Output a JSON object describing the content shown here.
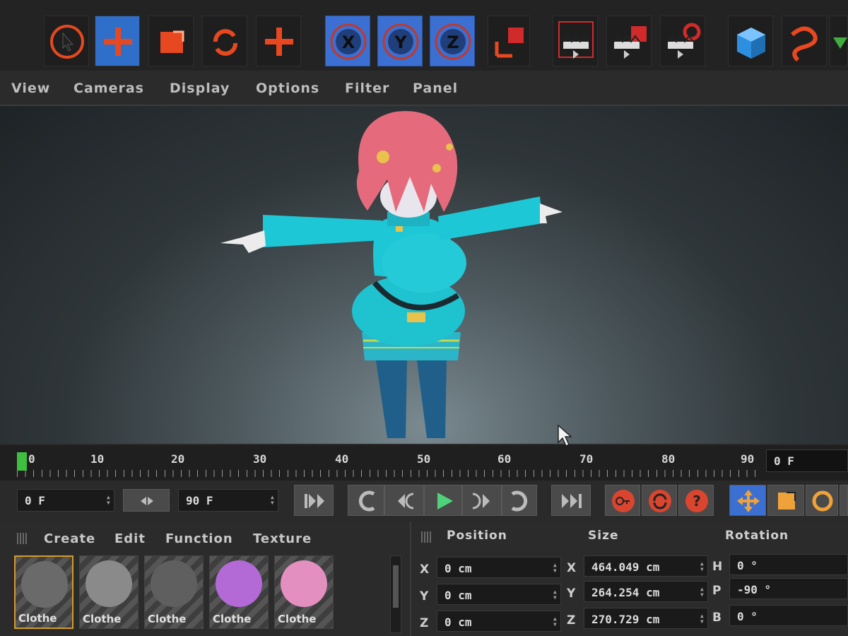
{
  "toolbar": {
    "tools": [
      {
        "name": "live-selection-icon"
      },
      {
        "name": "move-icon",
        "active": true
      },
      {
        "name": "scale-icon"
      },
      {
        "name": "rotate-icon"
      },
      {
        "name": "add-icon"
      }
    ],
    "axis_locks": [
      {
        "label": "X"
      },
      {
        "label": "Y"
      },
      {
        "label": "Z"
      }
    ],
    "right_tools": [
      {
        "name": "coordinate-system-icon"
      },
      {
        "name": "render-view-icon"
      },
      {
        "name": "render-to-picture-viewer-icon"
      },
      {
        "name": "render-settings-icon"
      },
      {
        "name": "cube-icon"
      },
      {
        "name": "spline-icon"
      }
    ],
    "accent_color": "#e8481f",
    "active_color": "#2f6fc9"
  },
  "viewport_menu": [
    "View",
    "Cameras",
    "Display",
    "Options",
    "Filter",
    "Panel"
  ],
  "timeline": {
    "ticks": [
      "0",
      "10",
      "20",
      "30",
      "40",
      "50",
      "60",
      "70",
      "80",
      "90"
    ],
    "current_frame_display": "0 F",
    "current_frame": 0,
    "max_frame": 90
  },
  "transport": {
    "start_field": "0 F",
    "end_field": "90 F",
    "buttons": [
      {
        "name": "go-to-start-icon"
      },
      {
        "name": "previous-key-icon"
      },
      {
        "name": "previous-frame-icon"
      },
      {
        "name": "play-icon"
      },
      {
        "name": "next-frame-icon"
      },
      {
        "name": "next-key-icon"
      },
      {
        "name": "go-to-end-icon"
      },
      {
        "name": "record-key-icon"
      },
      {
        "name": "autokey-icon"
      },
      {
        "name": "help-icon"
      }
    ]
  },
  "material_manager": {
    "menu": [
      "Create",
      "Edit",
      "Function",
      "Texture"
    ],
    "materials": [
      {
        "label": "Clothe",
        "color": "#6a6a6a"
      },
      {
        "label": "Clothe",
        "color": "#8a8a8a"
      },
      {
        "label": "Clothe",
        "color": "#5f5f5f"
      },
      {
        "label": "Clothe",
        "color": "#b36ad6"
      },
      {
        "label": "Clothe",
        "color": "#e38fc0"
      }
    ]
  },
  "coordinates": {
    "headers": {
      "position": "Position",
      "size": "Size",
      "rotation": "Rotation"
    },
    "rows": [
      {
        "axis": "X",
        "position": "0 cm",
        "size_axis": "X",
        "size": "464.049 cm",
        "rot_axis": "H",
        "rotation": "0 °"
      },
      {
        "axis": "Y",
        "position": "0 cm",
        "size_axis": "Y",
        "size": "264.254 cm",
        "rot_axis": "P",
        "rotation": "-90 °"
      },
      {
        "axis": "Z",
        "position": "0 cm",
        "size_axis": "Z",
        "size": "270.729 cm",
        "rot_axis": "B",
        "rotation": "0 °"
      }
    ]
  }
}
